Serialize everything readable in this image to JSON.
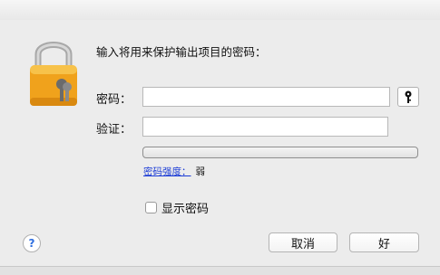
{
  "dialog": {
    "prompt": "输入将用来保护输出项目的密码：",
    "password_label": "密码：",
    "verify_label": "验证：",
    "password_value": "",
    "verify_value": "",
    "strength_link": "密码强度：",
    "strength_value": "弱",
    "strength_level": 0,
    "show_password_label": "显示密码",
    "show_password_checked": false,
    "help_label": "?",
    "cancel_label": "取消",
    "ok_label": "好"
  },
  "icons": {
    "lock": "lock-icon",
    "key": "key-icon",
    "help": "help-icon"
  },
  "colors": {
    "lock_body": "#f0a21c",
    "link": "#1a3bd6",
    "help": "#2f6fe0"
  }
}
